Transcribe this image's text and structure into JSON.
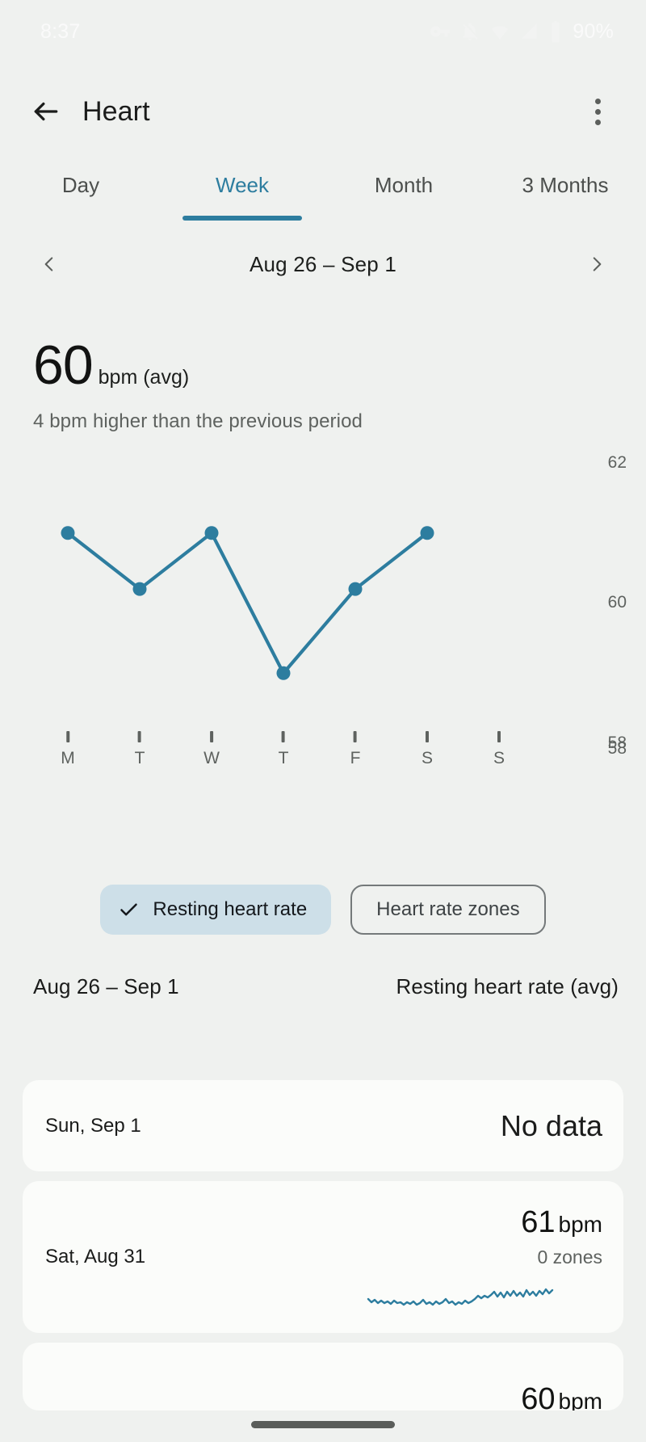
{
  "status_bar": {
    "time": "8:37",
    "battery_pct": "90%",
    "icons": [
      "vpn-key-icon",
      "ring-off-icon",
      "wifi-icon",
      "cellular-signal-icon",
      "battery-icon"
    ]
  },
  "app_bar": {
    "back_icon": "back-arrow-icon",
    "title": "Heart",
    "overflow_icon": "more-vert-icon"
  },
  "tabs": [
    {
      "label": "Day",
      "active": false
    },
    {
      "label": "Week",
      "active": true
    },
    {
      "label": "Month",
      "active": false
    },
    {
      "label": "3 Months",
      "active": false
    }
  ],
  "date_nav": {
    "prev_icon": "chevron-left-icon",
    "label": "Aug 26 – Sep 1",
    "next_icon": "chevron-right-icon"
  },
  "summary": {
    "value": "60",
    "unit": "bpm (avg)",
    "comparison": "4 bpm higher than the previous period"
  },
  "chips": [
    {
      "label": "Resting heart rate",
      "selected": true,
      "icon": "check-icon"
    },
    {
      "label": "Heart rate zones",
      "selected": false
    }
  ],
  "list_header": {
    "range": "Aug 26 – Sep 1",
    "metric": "Resting heart rate (avg)"
  },
  "cards": [
    {
      "day": "Sun, Sep 1",
      "value": "No data",
      "type": "nodata"
    },
    {
      "day": "Sat, Aug 31",
      "value": "61",
      "unit": "bpm",
      "zones": "0 zones",
      "type": "data"
    },
    {
      "value": "60",
      "unit": "bpm",
      "type": "partial"
    }
  ],
  "colors": {
    "accent": "#2d7d9f",
    "background": "#eff1ef",
    "card": "#fbfcfa",
    "chip_selected": "#cddfe8",
    "text_primary": "#1b1c1b",
    "text_secondary": "#5e625f"
  },
  "chart_data": {
    "type": "line",
    "title": "Resting heart rate",
    "xlabel": "",
    "ylabel": "bpm",
    "categories": [
      "M",
      "T",
      "W",
      "T",
      "F",
      "S",
      "S"
    ],
    "x_tick_labels": [
      "M",
      "T",
      "W",
      "T",
      "F",
      "S",
      "S"
    ],
    "y_tick_labels": [
      "62",
      "60",
      "58"
    ],
    "ylim": [
      58,
      62
    ],
    "grid": false,
    "legend": "none",
    "series": [
      {
        "name": "Resting heart rate (avg)",
        "values": [
          61,
          60.2,
          61,
          59,
          60.2,
          61,
          null
        ]
      }
    ]
  }
}
